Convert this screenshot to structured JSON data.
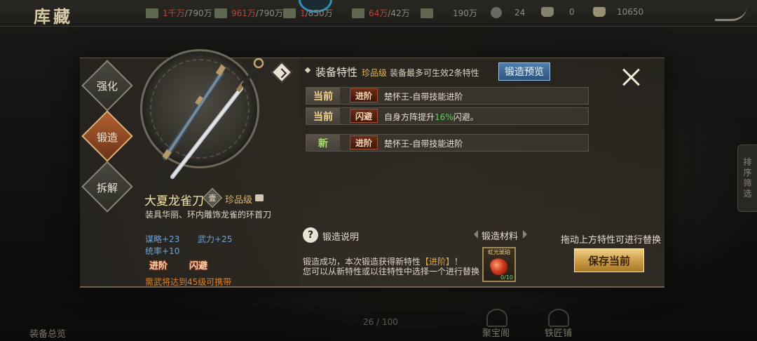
{
  "topbar": {
    "title": "库藏",
    "resources": [
      {
        "icon": "bamboo-icon",
        "current": "1千万",
        "total": "/790万"
      },
      {
        "icon": "grain-icon",
        "current": "961万",
        "total": "/790万"
      },
      {
        "icon": "ore-icon",
        "current": "1",
        "total": "/850万"
      },
      {
        "icon": "cloth-icon",
        "current": "64万",
        "total": "/42万"
      },
      {
        "icon": "troop-icon",
        "value": "190万"
      },
      {
        "icon": "coin-icon",
        "value": "24"
      },
      {
        "icon": "silver-icon",
        "value": "0"
      },
      {
        "icon": "gold-ingot-icon",
        "value": "10650"
      }
    ]
  },
  "nav": {
    "strengthen": "强化",
    "forge": "锻造",
    "dismantle": "拆解"
  },
  "item": {
    "name": "大夏龙雀刀",
    "grade_badge": "壹",
    "grade": "珍品级",
    "description": "装具华丽、环内雕饰龙雀的环首刀",
    "stats": {
      "strategy": "谋略+23",
      "force": "武力+25",
      "command": "统率+10"
    },
    "traits": [
      "进阶",
      "闪避"
    ],
    "requirement": "需武将达到45级可携带"
  },
  "traits_section": {
    "title": "装备特性",
    "grade": "珍品级",
    "note": "装备最多可生效2条特性",
    "preview_button": "锻造预览",
    "rows": [
      {
        "status": "当前",
        "tag": "进阶",
        "text": "楚怀王-自带技能进阶"
      },
      {
        "status": "当前",
        "tag": "闪避",
        "text_pre": "自身方阵提升",
        "text_highlight": "16%",
        "text_post": "闪避。"
      },
      {
        "status": "新",
        "tag": "进阶",
        "text": "楚怀王-自带技能进阶"
      }
    ]
  },
  "forge_info": {
    "help_label": "锻造说明",
    "result_line1_pre": "锻造成功，本次锻造获得新特性",
    "result_line1_hl": "【进阶】",
    "result_line1_post": "！",
    "result_line2": "您可以从新特性或以往特性中选择一个进行替换"
  },
  "material": {
    "label": "锻造材料",
    "name": "虹光琥珀",
    "count": "0/10"
  },
  "drag_hint": "拖动上方特性可进行替换",
  "save_button": "保存当前",
  "side_tab": [
    "排",
    "序",
    "筛",
    "选"
  ],
  "bottom": {
    "overview": "装备总览",
    "counter": "26 / 100",
    "treasure": "聚宝阁",
    "smith": "铁匠铺"
  },
  "colors": {
    "accent_gold": "#e0b85c",
    "highlight_green": "#5fd25a",
    "requirement_orange": "#d9812c",
    "preview_blue": "#2c5480"
  }
}
